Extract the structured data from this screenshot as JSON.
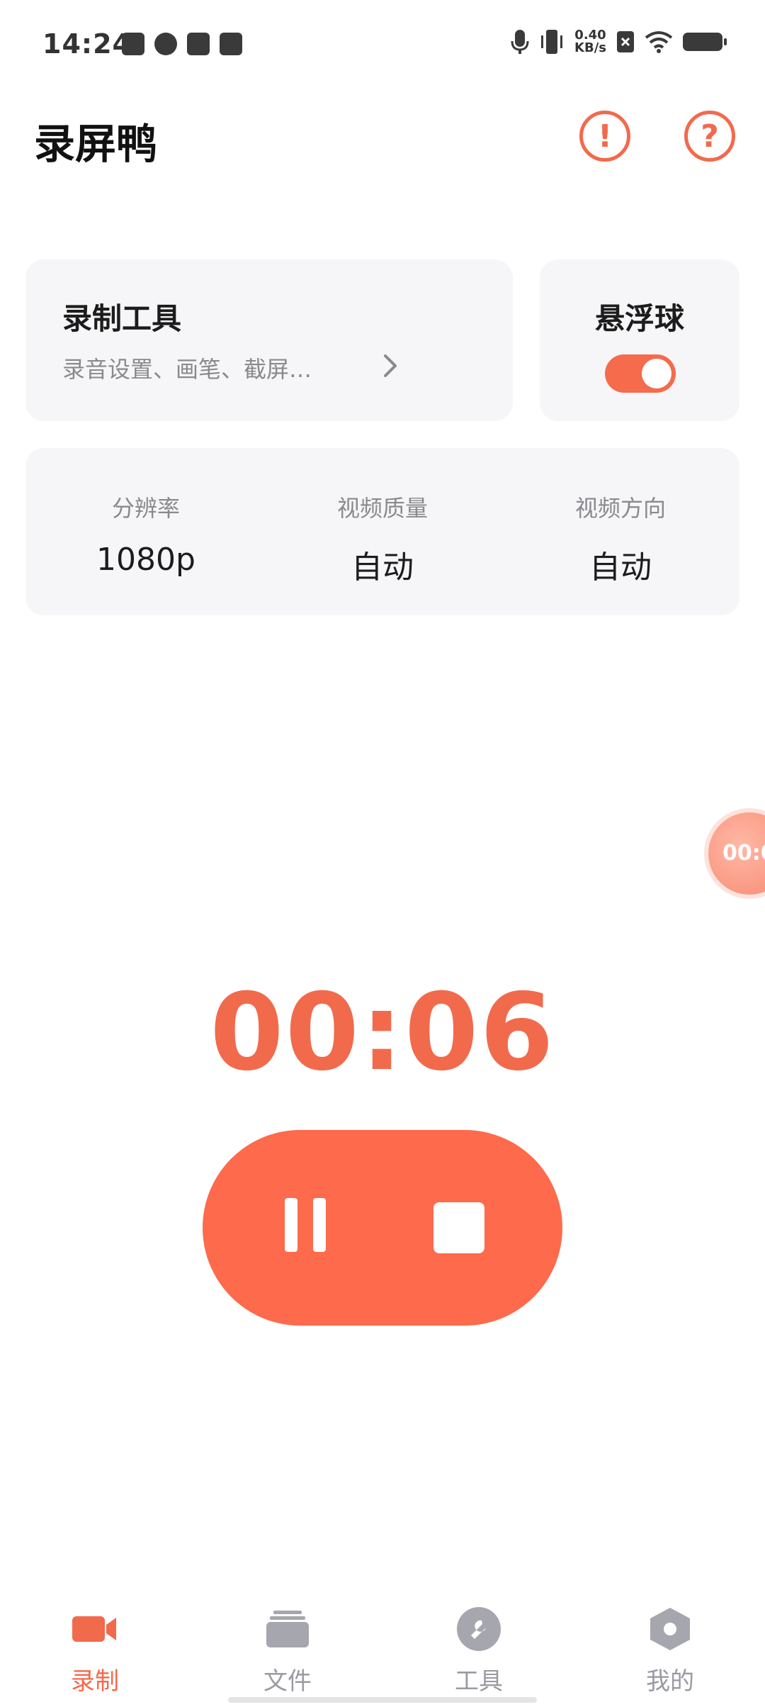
{
  "status_bar": {
    "time": "14:24",
    "net_speed_value": "0.40",
    "net_speed_unit": "KB/s",
    "icons": [
      "video-icon",
      "link-icon",
      "inbox-icon",
      "bag-icon",
      "mic-icon",
      "vibrate-icon",
      "sim-off-icon",
      "wifi-icon",
      "battery-icon"
    ]
  },
  "header": {
    "title": "录屏鸭",
    "notice_icon": "!",
    "help_icon": "?"
  },
  "tools_card": {
    "title": "录制工具",
    "subtitle": "录音设置、画笔、截屏…"
  },
  "float_ball_card": {
    "title": "悬浮球",
    "toggle_on": true,
    "toggle_color": "#f56b4c"
  },
  "settings": [
    {
      "label": "分辨率",
      "value": "1080p"
    },
    {
      "label": "视频质量",
      "value": "自动"
    },
    {
      "label": "视频方向",
      "value": "自动"
    }
  ],
  "floating_timer": "00:0",
  "timer": "00:06",
  "controls": {
    "pause_icon": "pause-icon",
    "stop_icon": "stop-icon",
    "color": "#fd6a4c"
  },
  "nav": [
    {
      "label": "录制",
      "icon": "video-camera-icon",
      "active": true
    },
    {
      "label": "文件",
      "icon": "folder-stack-icon",
      "active": false
    },
    {
      "label": "工具",
      "icon": "wrench-icon",
      "active": false
    },
    {
      "label": "我的",
      "icon": "hexagon-user-icon",
      "active": false
    }
  ],
  "accent_color": "#f26a4c"
}
